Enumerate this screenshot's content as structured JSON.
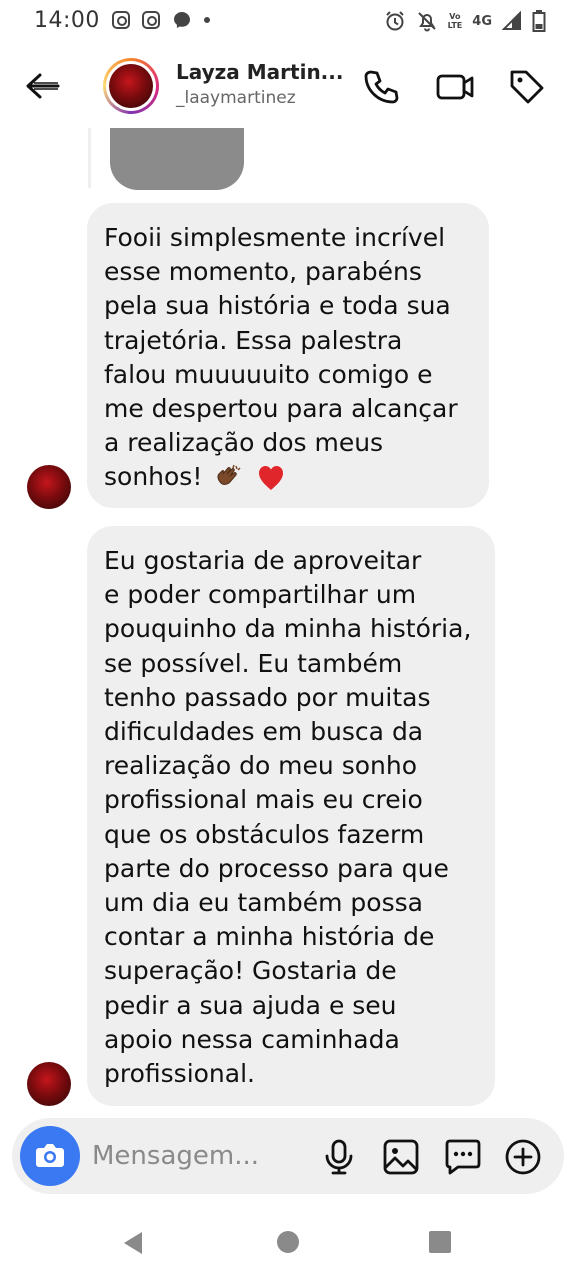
{
  "status_bar": {
    "time": "14:00",
    "network": "4G",
    "volte_top": "Vo",
    "volte_bottom": "LTE"
  },
  "header": {
    "name": "Layza Martin...",
    "username": "_laaymartinez"
  },
  "messages": [
    {
      "lines": [
        "Fooii simplesmente incrível",
        "esse momento, parabéns",
        "pela sua história e toda sua",
        "trajetória. Essa palestra",
        "falou muuuuuito comigo e",
        "me despertou para alcançar",
        "a realização dos meus",
        "sonhos!"
      ],
      "emojis": [
        "clapping-hands-medium-dark",
        "red-heart"
      ]
    },
    {
      "lines": [
        "Eu gostaria de aproveitar",
        "e poder compartilhar um",
        "pouquinho da minha história,",
        "se possível. Eu também",
        "tenho passado por muitas",
        "dificuldades em busca da",
        "realização do meu sonho",
        "profissional mais eu creio",
        "que os obstáculos fazerm",
        "parte do processo para que",
        "um dia eu também possa",
        "contar a minha história de",
        "superação! Gostaria de",
        "pedir a sua ajuda e seu",
        "apoio nessa caminhada",
        "profissional."
      ]
    }
  ],
  "composer": {
    "placeholder": "Mensagem..."
  },
  "colors": {
    "bubble": "#efefef",
    "camera_button": "#3a79f2",
    "media_thumb": "#8b8b8b"
  }
}
